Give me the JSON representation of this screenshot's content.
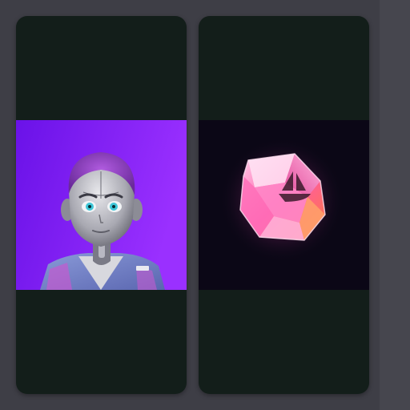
{
  "gallery": {
    "background_color": "#3e3e46",
    "card_color": "#131e1a",
    "cards": [
      {
        "subject": "avatar-portrait",
        "accent_colors": [
          "#6a12e8",
          "#9a30ff",
          "#c9c9cf",
          "#7fd8e6"
        ]
      },
      {
        "subject": "gem-crystal",
        "accent_colors": [
          "#0b0716",
          "#ff5aa8",
          "#ffb3dd",
          "#ff7a3a"
        ]
      }
    ]
  }
}
